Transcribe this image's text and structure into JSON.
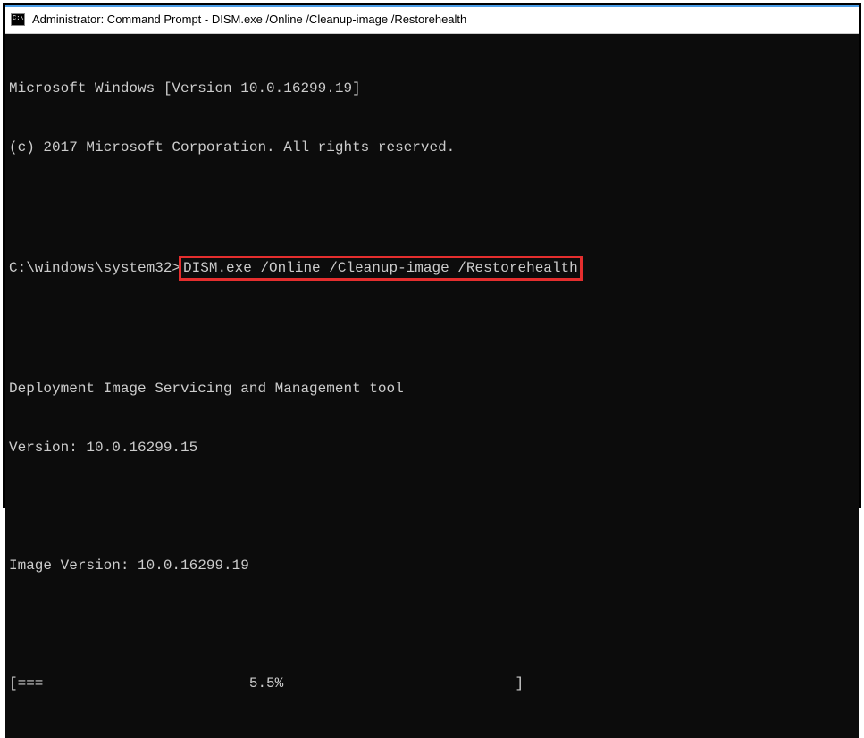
{
  "window": {
    "title": "Administrator: Command Prompt - DISM.exe  /Online /Cleanup-image /Restorehealth"
  },
  "terminal": {
    "version_line": "Microsoft Windows [Version 10.0.16299.19]",
    "copyright_line": "(c) 2017 Microsoft Corporation. All rights reserved.",
    "prompt": "C:\\windows\\system32>",
    "command": "DISM.exe /Online /Cleanup-image /Restorehealth",
    "tool_name": "Deployment Image Servicing and Management tool",
    "tool_version": "Version: 10.0.16299.15",
    "image_version": "Image Version: 10.0.16299.19",
    "progress_bar": "[===                        5.5%                           ]"
  }
}
